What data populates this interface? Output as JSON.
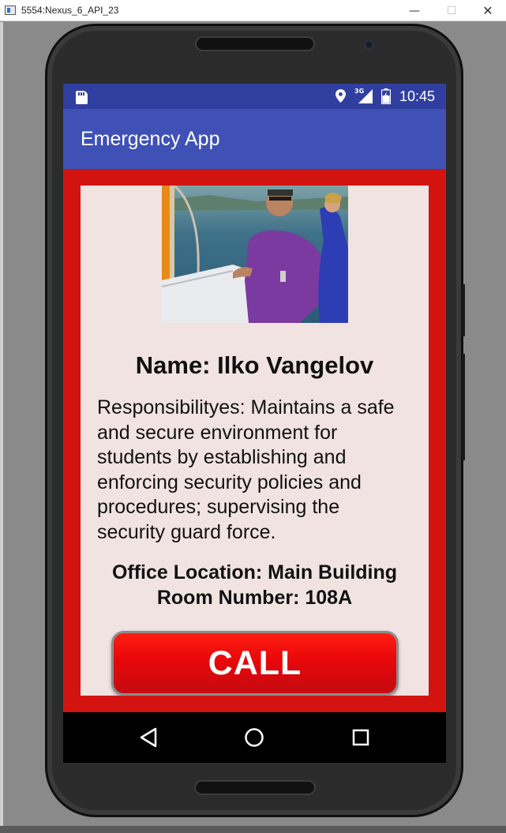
{
  "window": {
    "title": "5554:Nexus_6_API_23",
    "minimize": "—",
    "maximize": "☐",
    "close": "✕"
  },
  "status_bar": {
    "network_type": "3G",
    "time": "10:45",
    "icons": [
      "sd-card-icon",
      "location-icon",
      "signal-icon",
      "battery-icon"
    ]
  },
  "app_bar": {
    "title": "Emergency App"
  },
  "contact": {
    "name": "Name: Ilko Vangelov",
    "responsibilities": "Responsibilityes: Maintains a safe and secure environment for students by establishing and enforcing security policies and procedures; supervising the security guard force.",
    "office_location": "Office Location: Main Building",
    "room_number": "Room Number: 108A"
  },
  "actions": {
    "call_label": "CALL"
  },
  "nav_bar": {
    "items": [
      "back-icon",
      "home-icon",
      "recent-apps-icon"
    ]
  },
  "colors": {
    "status_bar": "#303f9f",
    "app_bar": "#3f51b5",
    "content_background": "#d21310",
    "card_background": "#f2e3e3",
    "call_button": "#e8070a"
  }
}
